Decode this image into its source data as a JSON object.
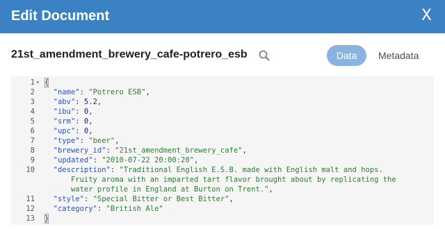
{
  "dialog": {
    "title": "Edit Document",
    "close_symbol": "X"
  },
  "document": {
    "id": "21st_amendment_brewery_cafe-potrero_esb"
  },
  "tabs": [
    {
      "label": "Data",
      "active": true
    },
    {
      "label": "Metadata",
      "active": false
    }
  ],
  "editor": {
    "lines": [
      {
        "num": "1",
        "fold": "▾",
        "text": "{"
      },
      {
        "num": "2",
        "key": "\"name\"",
        "sep": ": ",
        "value": "\"Potrero ESB\"",
        "vtype": "s",
        "tail": ","
      },
      {
        "num": "3",
        "key": "\"abv\"",
        "sep": ": ",
        "value": "5.2",
        "vtype": "n",
        "tail": ","
      },
      {
        "num": "4",
        "key": "\"ibu\"",
        "sep": ": ",
        "value": "0",
        "vtype": "n",
        "tail": ","
      },
      {
        "num": "5",
        "key": "\"srm\"",
        "sep": ": ",
        "value": "0",
        "vtype": "n",
        "tail": ","
      },
      {
        "num": "6",
        "key": "\"upc\"",
        "sep": ": ",
        "value": "0",
        "vtype": "n",
        "tail": ","
      },
      {
        "num": "7",
        "key": "\"type\"",
        "sep": ": ",
        "value": "\"beer\"",
        "vtype": "s",
        "tail": ","
      },
      {
        "num": "8",
        "key": "\"brewery_id\"",
        "sep": ": ",
        "value": "\"21st_amendment_brewery_cafe\"",
        "vtype": "s",
        "tail": ","
      },
      {
        "num": "9",
        "key": "\"updated\"",
        "sep": ": ",
        "value": "\"2010-07-22 20:00:20\"",
        "vtype": "s",
        "tail": ","
      },
      {
        "num": "10",
        "key": "\"description\"",
        "sep": ": ",
        "value": "\"Traditional English E.S.B. made with English malt and hops.",
        "vtype": "s",
        "tail": ""
      },
      {
        "num": "",
        "cont": "Fruity aroma with an imparted tart flavor brought about by replicating the",
        "vtype": "s"
      },
      {
        "num": "",
        "cont": "water profile in England at Burton on Trent.\"",
        "vtype": "s",
        "tail": ","
      },
      {
        "num": "11",
        "key": "\"style\"",
        "sep": ": ",
        "value": "\"Special Bitter or Best Bitter\"",
        "vtype": "s",
        "tail": ","
      },
      {
        "num": "12",
        "key": "\"category\"",
        "sep": ": ",
        "value": "\"British Ale\"",
        "vtype": "s",
        "tail": ""
      },
      {
        "num": "13",
        "text": "}"
      }
    ]
  }
}
